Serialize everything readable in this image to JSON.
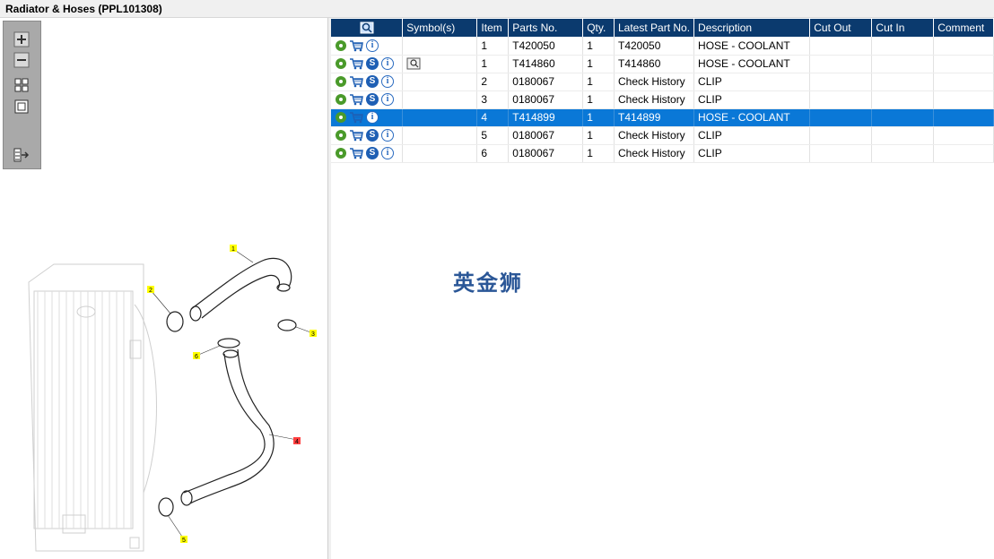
{
  "window": {
    "title": "Radiator & Hoses (PPL101308)"
  },
  "toolbar": {
    "buttons": [
      {
        "name": "zoom-in-button",
        "icon": "plus-icon"
      },
      {
        "name": "zoom-out-button",
        "icon": "minus-icon"
      },
      {
        "name": "fit-all-button",
        "icon": "grid-icon"
      },
      {
        "name": "reset-view-button",
        "icon": "square-icon"
      },
      {
        "name": "export-button",
        "icon": "list-arrow-icon"
      }
    ]
  },
  "diagram": {
    "callouts": [
      "1",
      "2",
      "3",
      "4",
      "5",
      "6"
    ]
  },
  "table": {
    "columns": [
      "",
      "Symbol(s)",
      "Item",
      "Parts No.",
      "Qty.",
      "Latest Part No.",
      "Description",
      "Cut Out",
      "Cut In",
      "Comment"
    ],
    "rows": [
      {
        "has_s": false,
        "symbol": false,
        "item": "1",
        "parts_no": "T420050",
        "qty": "1",
        "latest": "T420050",
        "description": "HOSE - COOLANT",
        "cut_out": "",
        "cut_in": "",
        "comment": "",
        "selected": false
      },
      {
        "has_s": true,
        "symbol": true,
        "item": "1",
        "parts_no": "T414860",
        "qty": "1",
        "latest": "T414860",
        "description": "HOSE - COOLANT",
        "cut_out": "",
        "cut_in": "",
        "comment": "",
        "selected": false
      },
      {
        "has_s": true,
        "symbol": false,
        "item": "2",
        "parts_no": "0180067",
        "qty": "1",
        "latest": "Check History",
        "description": "CLIP",
        "cut_out": "",
        "cut_in": "",
        "comment": "",
        "selected": false
      },
      {
        "has_s": true,
        "symbol": false,
        "item": "3",
        "parts_no": "0180067",
        "qty": "1",
        "latest": "Check History",
        "description": "CLIP",
        "cut_out": "",
        "cut_in": "",
        "comment": "",
        "selected": false
      },
      {
        "has_s": false,
        "symbol": false,
        "item": "4",
        "parts_no": "T414899",
        "qty": "1",
        "latest": "T414899",
        "description": "HOSE - COOLANT",
        "cut_out": "",
        "cut_in": "",
        "comment": "",
        "selected": true
      },
      {
        "has_s": true,
        "symbol": false,
        "item": "5",
        "parts_no": "0180067",
        "qty": "1",
        "latest": "Check History",
        "description": "CLIP",
        "cut_out": "",
        "cut_in": "",
        "comment": "",
        "selected": false
      },
      {
        "has_s": true,
        "symbol": false,
        "item": "6",
        "parts_no": "0180067",
        "qty": "1",
        "latest": "Check History",
        "description": "CLIP",
        "cut_out": "",
        "cut_in": "",
        "comment": "",
        "selected": false
      }
    ]
  },
  "watermark": {
    "text": "英金狮"
  },
  "colors": {
    "header_bg": "#0b3a6e",
    "selected_row": "#0a78d7",
    "callout_yellow": "#ffff00",
    "callout_red": "#ff4040"
  }
}
